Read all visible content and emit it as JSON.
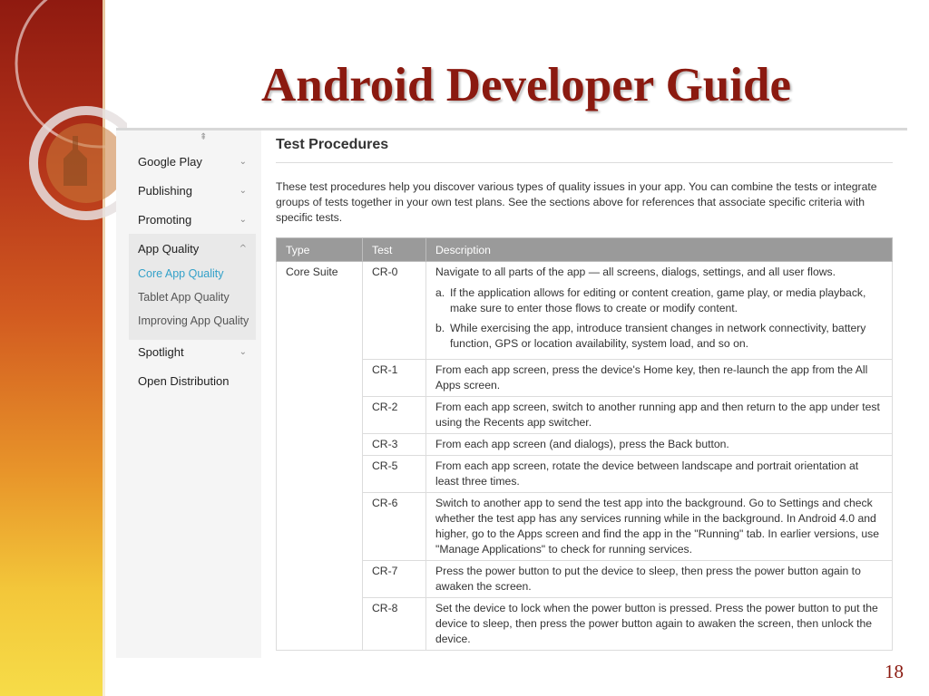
{
  "slide": {
    "title": "Android Developer Guide",
    "number": "18"
  },
  "nav": {
    "items": [
      {
        "label": "Google Play",
        "chevron": "⌄"
      },
      {
        "label": "Publishing",
        "chevron": "⌄"
      },
      {
        "label": "Promoting",
        "chevron": "⌄"
      },
      {
        "label": "App Quality",
        "chevron": "^"
      },
      {
        "label": "Spotlight",
        "chevron": "⌄"
      },
      {
        "label": "Open Distribution",
        "chevron": ""
      }
    ],
    "sub_items": [
      {
        "label": "Core App Quality",
        "active": true
      },
      {
        "label": "Tablet App Quality",
        "active": false
      },
      {
        "label": "Improving App Quality",
        "active": false
      }
    ]
  },
  "content": {
    "section_title": "Test Procedures",
    "intro": "These test procedures help you discover various types of quality issues in your app. You can combine the tests or integrate groups of tests together in your own test plans. See the sections above for references that associate specific criteria with specific tests.",
    "table": {
      "headers": [
        "Type",
        "Test",
        "Description"
      ],
      "type_label": "Core Suite",
      "rows": [
        {
          "test": "CR-0",
          "description": "Navigate to all parts of the app — all screens, dialogs, settings, and all user flows.",
          "sub": [
            {
              "mark": "a.",
              "text": "If the application allows for editing or content creation, game play, or media playback, make sure to enter those flows to create or modify content."
            },
            {
              "mark": "b.",
              "text": "While exercising the app, introduce transient changes in network connectivity, battery function, GPS or location availability, system load, and so on."
            }
          ]
        },
        {
          "test": "CR-1",
          "description": "From each app screen, press the device's Home key, then re-launch the app from the All Apps screen."
        },
        {
          "test": "CR-2",
          "description": "From each app screen, switch to another running app and then return to the app under test using the Recents app switcher."
        },
        {
          "test": "CR-3",
          "description": "From each app screen (and dialogs), press the Back button."
        },
        {
          "test": "CR-5",
          "description": "From each app screen, rotate the device between landscape and portrait orientation at least three times."
        },
        {
          "test": "CR-6",
          "description": "Switch to another app to send the test app into the background. Go to Settings and check whether the test app has any services running while in the background. In Android 4.0 and higher, go to the Apps screen and find the app in the \"Running\" tab. In earlier versions, use \"Manage Applications\" to check for running services."
        },
        {
          "test": "CR-7",
          "description": "Press the power button to put the device to sleep, then press the power button again to awaken the screen."
        },
        {
          "test": "CR-8",
          "description": "Set the device to lock when the power button is pressed. Press the power button to put the device to sleep, then press the power button again to awaken the screen, then unlock the device."
        }
      ]
    }
  },
  "colors": {
    "title": "#8b1a10",
    "active_link": "#33a1c9",
    "table_header": "#9a9a9a"
  }
}
